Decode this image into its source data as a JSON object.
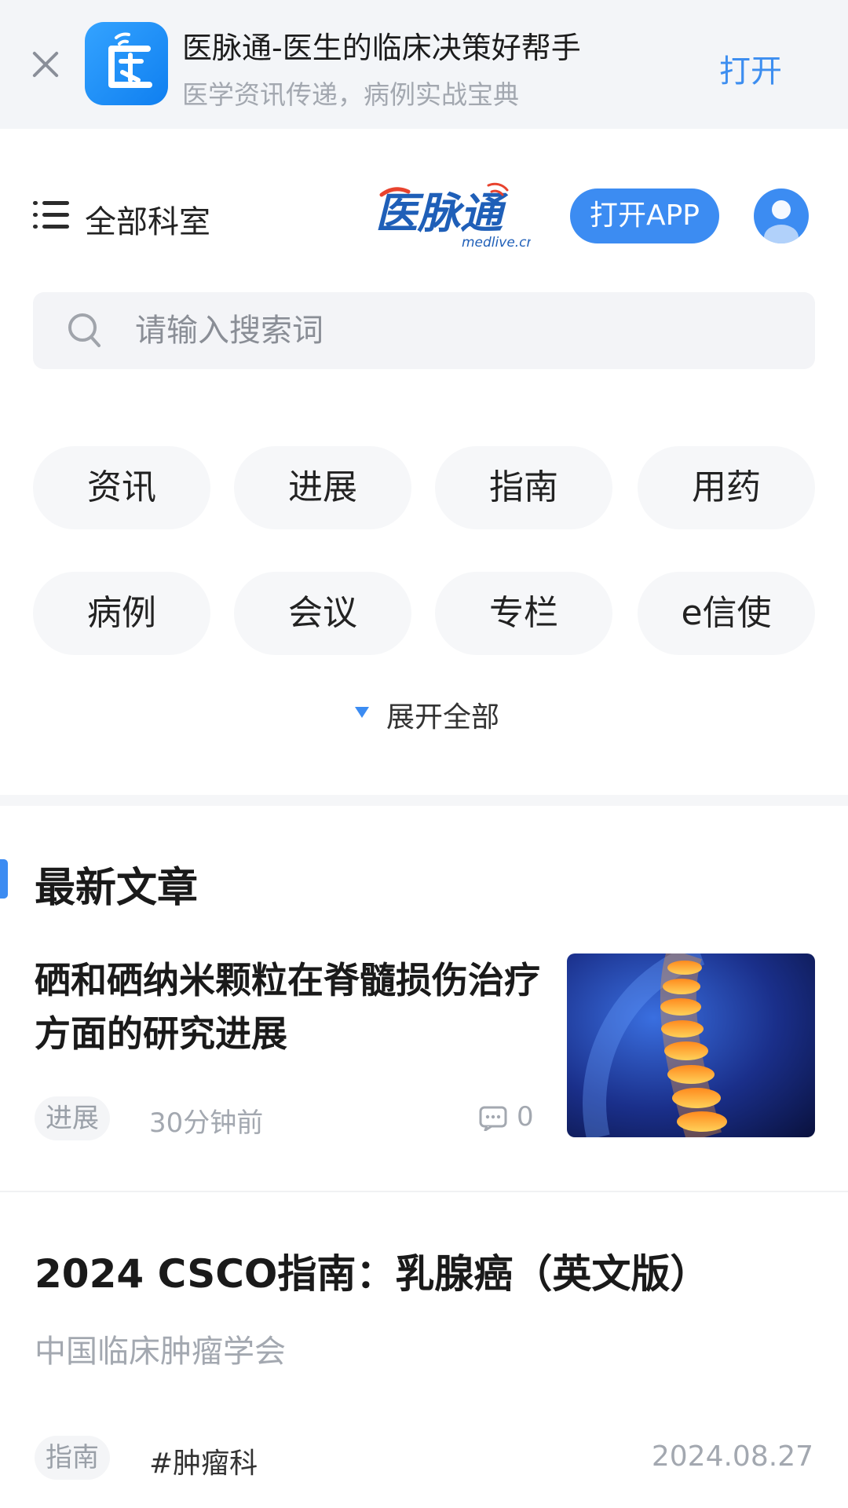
{
  "banner": {
    "app_name": "医脉通-医生的临床决策好帮手",
    "subtitle": "医学资讯传递，病例实战宝典",
    "open_label": "打开"
  },
  "header": {
    "departments_label": "全部科室",
    "logo_text": "医脉通",
    "logo_domain": "medlive.cn",
    "open_app_label": "打开APP"
  },
  "search": {
    "placeholder": "请输入搜索词"
  },
  "categories": [
    "资讯",
    "进展",
    "指南",
    "用药",
    "病例",
    "会议",
    "专栏",
    "e信使"
  ],
  "expand_label": "展开全部",
  "section": {
    "title": "最新文章"
  },
  "articles": [
    {
      "title": "硒和硒纳米颗粒在脊髓损伤治疗方面的研究进展",
      "tag": "进展",
      "time": "30分钟前",
      "comments": "0"
    },
    {
      "title": "2024 CSCO指南：乳腺癌（英文版）",
      "source": "中国临床肿瘤学会",
      "tag": "指南",
      "department": "#肿瘤科",
      "date": "2024.08.27"
    }
  ],
  "colors": {
    "accent": "#3c8cf2",
    "banner_bg": "#f3f5f8",
    "muted_text": "#a3a8b0"
  }
}
